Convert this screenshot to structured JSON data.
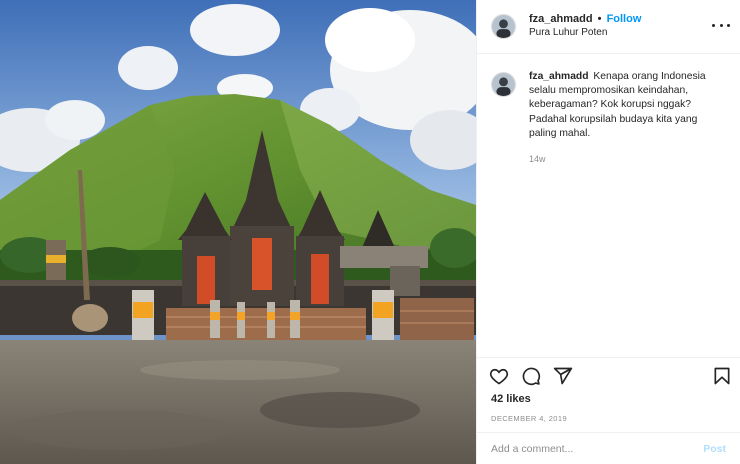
{
  "header": {
    "username": "fza_ahmadd",
    "separator": "•",
    "follow_label": "Follow",
    "location": "Pura Luhur Poten",
    "more_icon": "more-horizontal-icon"
  },
  "caption": {
    "username": "fza_ahmadd",
    "text": "Kenapa orang Indonesia selalu mempromosikan keindahan, keberagaman? Kok korupsi nggak? Padahal korupsilah budaya kita yang paling mahal.",
    "time_ago": "14w"
  },
  "actions": {
    "icons": [
      "heart-icon",
      "comment-icon",
      "share-icon",
      "bookmark-icon"
    ],
    "likes": "42 likes",
    "date": "DECEMBER 4, 2019"
  },
  "comment_box": {
    "placeholder": "Add a comment...",
    "post_label": "Post"
  },
  "colors": {
    "link_blue": "#0095f6",
    "post_disabled": "#b2dffc",
    "muted": "#8e8e8e",
    "text": "#262626"
  }
}
